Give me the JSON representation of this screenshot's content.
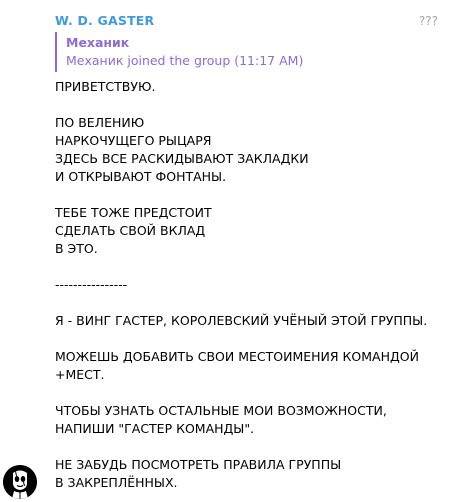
{
  "message": {
    "sender": "W. D. GASTER",
    "badge": "???",
    "reply": {
      "name": "Механик",
      "text": "Механик joined the group (11:17 AM)"
    },
    "lines": [
      "ПРИВЕТСТВУЮ.",
      "",
      "ПО ВЕЛЕНИЮ",
      "НАРКОЧУЩЕГО РЫЦАРЯ",
      "ЗДЕСЬ ВСЕ РАСКИДЫВАЮТ ЗАКЛАДКИ",
      "И ОТКРЫВАЮТ ФОНТАНЫ.",
      "",
      "ТЕБЕ ТОЖЕ ПРЕДСТОИТ",
      "СДЕЛАТЬ СВОЙ ВКЛАД",
      "В ЭТО.",
      "",
      "----------------",
      "",
      "Я - ВИНГ ГАСТЕР, КОРОЛЕВСКИЙ УЧЁНЫЙ ЭТОЙ ГРУППЫ.",
      "",
      "МОЖЕШЬ ДОБАВИТЬ СВОИ МЕСТОИМЕНИЯ КОМАНДОЙ",
      "+МЕСТ.",
      "",
      "ЧТОБЫ УЗНАТЬ ОСТАЛЬНЫЕ МОИ ВОЗМОЖНОСТИ,",
      "НАПИШИ \"ГАСТЕР КОМАНДЫ\".",
      "",
      "НЕ ЗАБУДЬ ПОСМОТРЕТЬ ПРАВИЛА ГРУППЫ",
      "В ЗАКРЕПЛЁННЫХ."
    ]
  },
  "avatar": {
    "icon": "gaster-face-icon"
  },
  "colors": {
    "sender": "#3d9be0",
    "reply_accent": "#8e6bd6",
    "badge": "#a6a6a6",
    "text": "#000000",
    "background": "#ffffff"
  }
}
